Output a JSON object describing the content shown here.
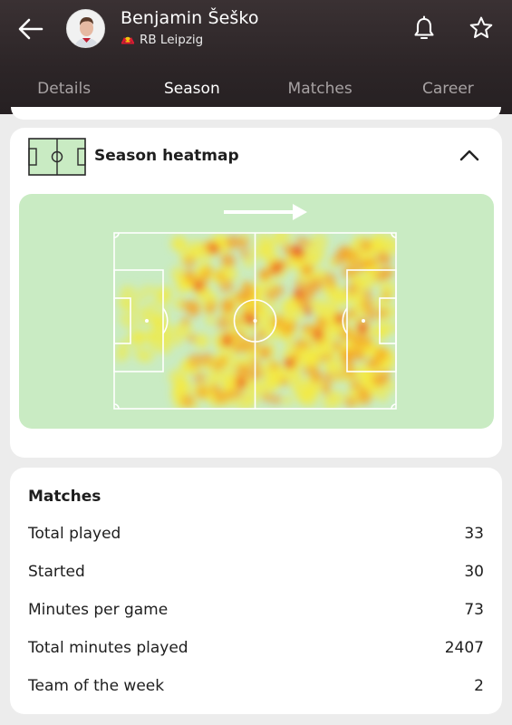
{
  "header": {
    "player_name": "Benjamin Šeško",
    "club": "RB Leipzig"
  },
  "tabs": [
    {
      "label": "Details",
      "active": false
    },
    {
      "label": "Season",
      "active": true
    },
    {
      "label": "Matches",
      "active": false
    },
    {
      "label": "Career",
      "active": false
    }
  ],
  "heatmap": {
    "title": "Season heatmap",
    "icon": "pitch-icon",
    "colors": {
      "pitch": "#c9ebc3",
      "low": "#f5ea3a",
      "mid": "#f79a1e",
      "high": "#e4262a"
    }
  },
  "matches": {
    "title": "Matches",
    "rows": [
      {
        "label": "Total played",
        "value": "33"
      },
      {
        "label": "Started",
        "value": "30"
      },
      {
        "label": "Minutes per game",
        "value": "73"
      },
      {
        "label": "Total minutes played",
        "value": "2407"
      },
      {
        "label": "Team of the week",
        "value": "2"
      }
    ]
  }
}
